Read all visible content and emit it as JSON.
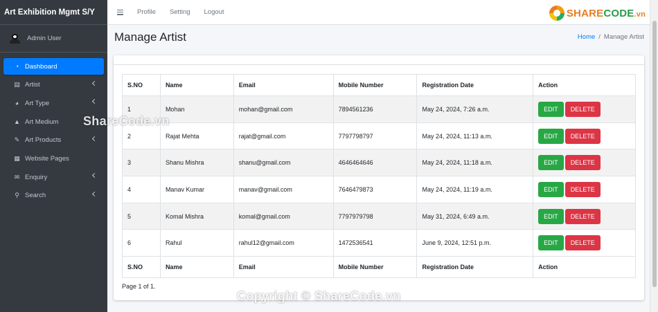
{
  "brand": "Art Exhibition Mgmt S/Y",
  "user": {
    "name": "Admin User"
  },
  "sidebar": {
    "items": [
      {
        "label": "Dashboard",
        "icon": "dashboard-icon",
        "active": true,
        "chevron": false
      },
      {
        "label": "Artist",
        "icon": "copy-icon",
        "active": false,
        "chevron": true
      },
      {
        "label": "Art Type",
        "icon": "pie-chart-icon",
        "active": false,
        "chevron": true
      },
      {
        "label": "Art Medium",
        "icon": "bell-icon",
        "active": false,
        "chevron": false
      },
      {
        "label": "Art Products",
        "icon": "edit-icon",
        "active": false,
        "chevron": true
      },
      {
        "label": "Website Pages",
        "icon": "calendar-icon",
        "active": false,
        "chevron": false
      },
      {
        "label": "Enquiry",
        "icon": "envelope-icon",
        "active": false,
        "chevron": true
      },
      {
        "label": "Search",
        "icon": "search-icon",
        "active": false,
        "chevron": true
      }
    ]
  },
  "topbar": {
    "links": [
      "Profile",
      "Setting",
      "Logout"
    ],
    "logo": {
      "part1": "SHARE",
      "part2": "CODE",
      "part3": ".vn"
    }
  },
  "page": {
    "title": "Manage Artist",
    "breadcrumb": {
      "home": "Home",
      "current": "Manage Artist"
    }
  },
  "table": {
    "headers": [
      "S.NO",
      "Name",
      "Email",
      "Mobile Number",
      "Registration Date",
      "Action"
    ],
    "rows": [
      {
        "sno": "1",
        "name": "Mohan",
        "email": "mohan@gmail.com",
        "mobile": "7894561236",
        "date": "May 24, 2024, 7:26 a.m."
      },
      {
        "sno": "2",
        "name": "Rajat Mehta",
        "email": "rajat@gmail.com",
        "mobile": "7797798797",
        "date": "May 24, 2024, 11:13 a.m."
      },
      {
        "sno": "3",
        "name": "Shanu Mishra",
        "email": "shanu@gmail.com",
        "mobile": "4646464646",
        "date": "May 24, 2024, 11:18 a.m."
      },
      {
        "sno": "4",
        "name": "Manav Kumar",
        "email": "manav@gmail.com",
        "mobile": "7646479873",
        "date": "May 24, 2024, 11:19 a.m."
      },
      {
        "sno": "5",
        "name": "Komal Mishra",
        "email": "komal@gmail.com",
        "mobile": "7797979798",
        "date": "May 31, 2024, 6:49 a.m."
      },
      {
        "sno": "6",
        "name": "Rahul",
        "email": "rahul12@gmail.com",
        "mobile": "1472536541",
        "date": "June 9, 2024, 12:51 p.m."
      }
    ],
    "edit_label": "EDIT",
    "delete_label": "DELETE"
  },
  "pager": "Page 1 of 1.",
  "watermarks": {
    "middle": "ShareCode.vn",
    "bottom": "Copyright © ShareCode.vn"
  },
  "colors": {
    "sidebar": "#343a40",
    "active": "#007bff",
    "edit": "#28a745",
    "delete": "#dc3545"
  }
}
